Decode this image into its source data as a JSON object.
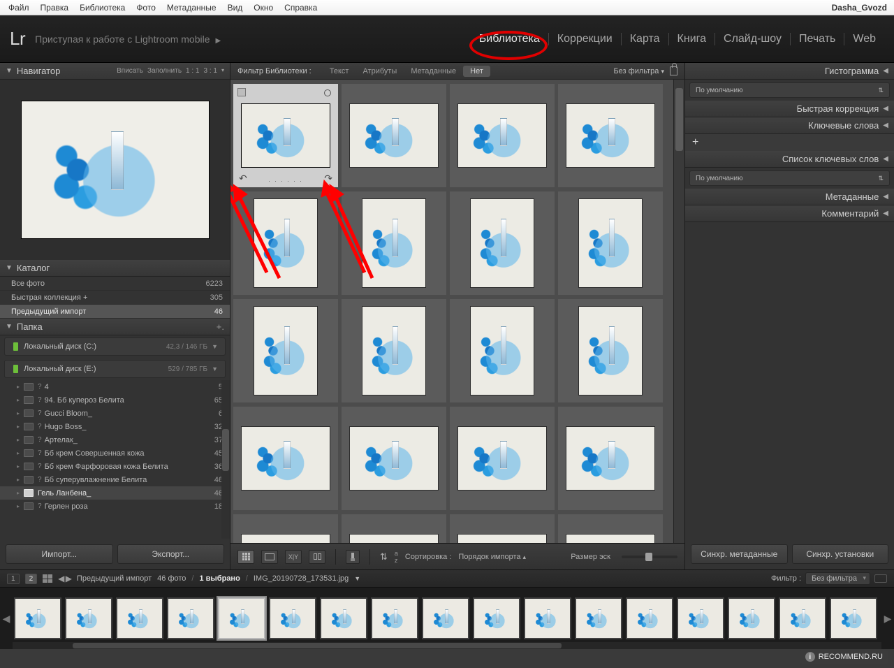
{
  "menubar": {
    "items": [
      "Файл",
      "Правка",
      "Библиотека",
      "Фото",
      "Метаданные",
      "Вид",
      "Окно",
      "Справка"
    ],
    "user": "Dasha_Gvozd"
  },
  "header": {
    "logo": "Lr",
    "getting_started": "Приступая к работе с Lightroom mobile",
    "modules": [
      "Библиотека",
      "Коррекции",
      "Карта",
      "Книга",
      "Слайд-шоу",
      "Печать",
      "Web"
    ],
    "active_module_index": 0
  },
  "left": {
    "navigator": {
      "title": "Навигатор",
      "fit": "Вписать",
      "fill": "Заполнить",
      "one": "1 : 1",
      "three": "3 : 1"
    },
    "catalog": {
      "title": "Каталог",
      "rows": [
        {
          "label": "Все фото",
          "count": "6223"
        },
        {
          "label": "Быстрая коллекция  +",
          "count": "305"
        },
        {
          "label": "Предыдущий импорт",
          "count": "46"
        }
      ],
      "selected_index": 2
    },
    "folders": {
      "title": "Папка",
      "drives": [
        {
          "name": "Локальный диск (C:)",
          "stat": "42,3 / 146 ГБ"
        },
        {
          "name": "Локальный диск (E:)",
          "stat": "529 / 785 ГБ"
        }
      ],
      "tree": [
        {
          "label": "4",
          "count": "5",
          "q": true
        },
        {
          "label": "94. Бб купероз Белита",
          "count": "65",
          "q": true
        },
        {
          "label": "Gucci Bloom_",
          "count": "6",
          "q": true
        },
        {
          "label": "Hugo Boss_",
          "count": "32",
          "q": true
        },
        {
          "label": "Артелак_",
          "count": "37",
          "q": true
        },
        {
          "label": "Бб крем Совершенная кожа",
          "count": "45",
          "q": true
        },
        {
          "label": "Бб крем Фарфоровая кожа Белита",
          "count": "36",
          "q": true
        },
        {
          "label": "Бб суперувлажнение Белита",
          "count": "46",
          "q": true
        },
        {
          "label": "Гель Ланбена_",
          "count": "46",
          "q": false,
          "active": true
        },
        {
          "label": "Герлен роза",
          "count": "18",
          "q": true
        }
      ]
    },
    "import_btn": "Импорт...",
    "export_btn": "Экспорт..."
  },
  "filter": {
    "label": "Фильтр Библиотеки :",
    "tabs": [
      "Текст",
      "Атрибуты",
      "Метаданные",
      "Нет"
    ],
    "active_index": 3,
    "preset": "Без фильтра"
  },
  "grid": {
    "cells": [
      {
        "o": "land",
        "sel": true
      },
      {
        "o": "land"
      },
      {
        "o": "land"
      },
      {
        "o": "land"
      },
      {
        "o": "port"
      },
      {
        "o": "port"
      },
      {
        "o": "port"
      },
      {
        "o": "port"
      },
      {
        "o": "port"
      },
      {
        "o": "port"
      },
      {
        "o": "port"
      },
      {
        "o": "port"
      },
      {
        "o": "land"
      },
      {
        "o": "land"
      },
      {
        "o": "land"
      },
      {
        "o": "land"
      },
      {
        "o": "land"
      },
      {
        "o": "land"
      },
      {
        "o": "land"
      },
      {
        "o": "land"
      }
    ]
  },
  "center_toolbar": {
    "sort_label": "Сортировка :",
    "sort_value": "Порядок импорта",
    "size_label": "Размер эск"
  },
  "right": {
    "panels": [
      "Гистограмма",
      "Быстрая коррекция",
      "Ключевые слова",
      "Список ключевых слов",
      "Метаданные",
      "Комментарий"
    ],
    "default_label": "По умолчанию",
    "sync_meta": "Синхр. метаданные",
    "sync_settings": "Синхр. установки"
  },
  "filmstrip": {
    "crumb1": "Предыдущий импорт",
    "crumb2": "46 фото",
    "crumb3": "1 выбрано",
    "crumb4": "IMG_20190728_173531.jpg",
    "filter_label": "Фильтр :",
    "filter_value": "Без фильтра"
  },
  "watermark": "RECOMMEND.RU"
}
